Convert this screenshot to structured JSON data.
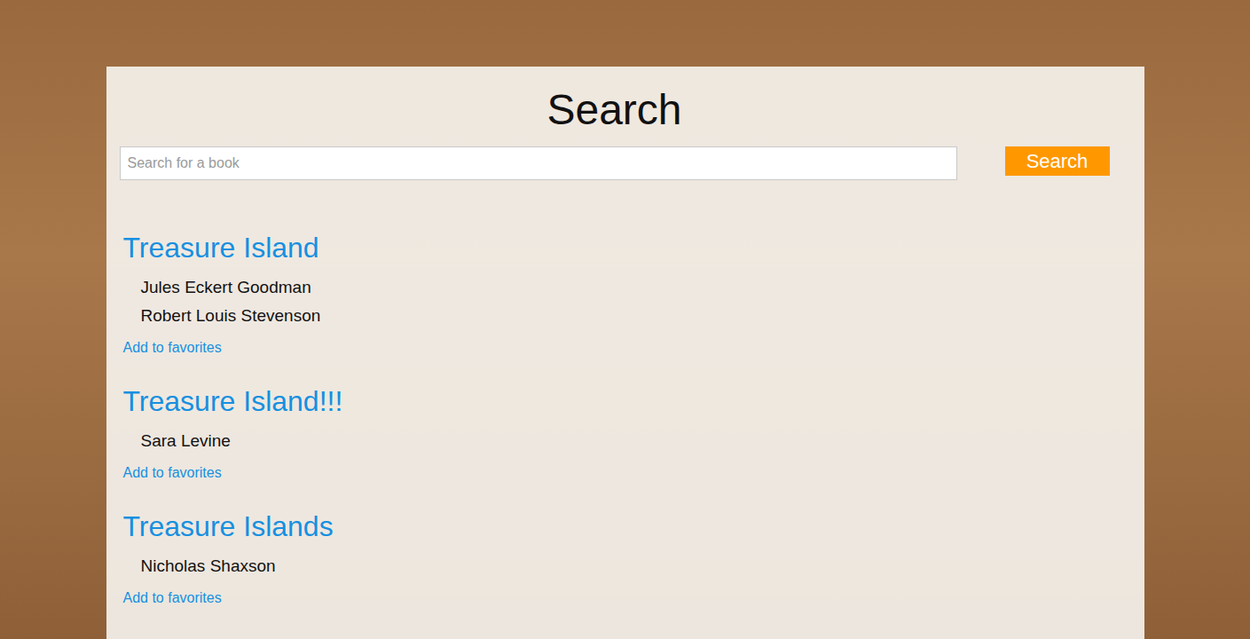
{
  "page": {
    "title": "Search"
  },
  "search": {
    "placeholder": "Search for a book",
    "button": "Search"
  },
  "results": [
    {
      "title": "Treasure Island",
      "authors": [
        "Jules Eckert Goodman",
        "Robert Louis Stevenson"
      ],
      "action": "Add to favorites"
    },
    {
      "title": "Treasure Island!!!",
      "authors": [
        "Sara Levine"
      ],
      "action": "Add to favorites"
    },
    {
      "title": "Treasure Islands",
      "authors": [
        "Nicholas Shaxson"
      ],
      "action": "Add to favorites"
    }
  ]
}
